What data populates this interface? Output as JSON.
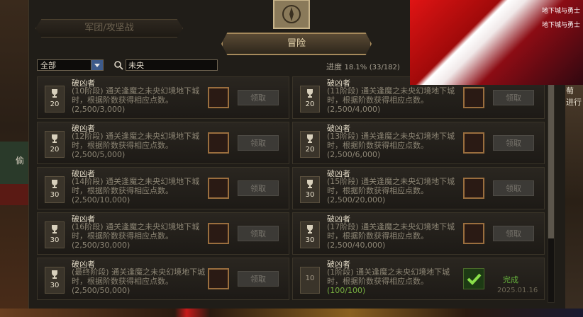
{
  "tabs": {
    "left": "军团/攻坚战",
    "active": "冒险"
  },
  "filter": {
    "selected": "全部"
  },
  "search": {
    "value": "未央"
  },
  "progress": {
    "label": "进度",
    "percent": "18.1%",
    "count": "(33/182)"
  },
  "side": {
    "right_text_1": "萄",
    "right_text_2": "进行",
    "left_text": "偷"
  },
  "ad": {
    "logo1": "地下城与勇士",
    "logo2": "地下城与勇士"
  },
  "cards": [
    {
      "title": "破凶者",
      "desc": "(10阶段) 通关逢魔之未央幻境地下城时，根据阶数获得相应点数。",
      "count": "(2,500/3,000)",
      "num": "20",
      "button": "领取"
    },
    {
      "title": "破凶者",
      "desc": "(11阶段) 通关逢魔之未央幻境地下城时，根据阶数获得相应点数。",
      "count": "(2,500/4,000)",
      "num": "20",
      "button": "领取"
    },
    {
      "title": "破凶者",
      "desc": "(12阶段) 通关逢魔之未央幻境地下城时，根据阶数获得相应点数。",
      "count": "(2,500/5,000)",
      "num": "20",
      "button": "领取"
    },
    {
      "title": "破凶者",
      "desc": "(13阶段) 通关逢魔之未央幻境地下城时，根据阶数获得相应点数。",
      "count": "(2,500/6,000)",
      "num": "20",
      "button": "领取"
    },
    {
      "title": "破凶者",
      "desc": "(14阶段) 通关逢魔之未央幻境地下城时，根据阶数获得相应点数。",
      "count": "(2,500/10,000)",
      "num": "30",
      "button": "领取"
    },
    {
      "title": "破凶者",
      "desc": "(15阶段) 通关逢魔之未央幻境地下城时，根据阶数获得相应点数。",
      "count": "(2,500/20,000)",
      "num": "30",
      "button": "领取"
    },
    {
      "title": "破凶者",
      "desc": "(16阶段) 通关逢魔之未央幻境地下城时，根据阶数获得相应点数。",
      "count": "(2,500/30,000)",
      "num": "30",
      "button": "领取"
    },
    {
      "title": "破凶者",
      "desc": "(17阶段) 通关逢魔之未央幻境地下城时，根据阶数获得相应点数。",
      "count": "(2,500/40,000)",
      "num": "30",
      "button": "领取"
    },
    {
      "title": "破凶者",
      "desc": "(最终阶段) 通关逢魔之未央幻境地下城时，根据阶数获得相应点数。",
      "count": "(2,500/50,000)",
      "num": "30",
      "button": "领取"
    },
    {
      "title": "破凶者",
      "desc": "(1阶段) 通关逢魔之未央幻境地下城时，根据阶数获得相应点数。",
      "count": "(100/100)",
      "num": "10",
      "status": "完成",
      "date": "2025.01.16"
    }
  ],
  "colors": {
    "done": "#66b23c",
    "button_disabled": "#3c3a36",
    "reward_border": "#9a6e3e"
  }
}
